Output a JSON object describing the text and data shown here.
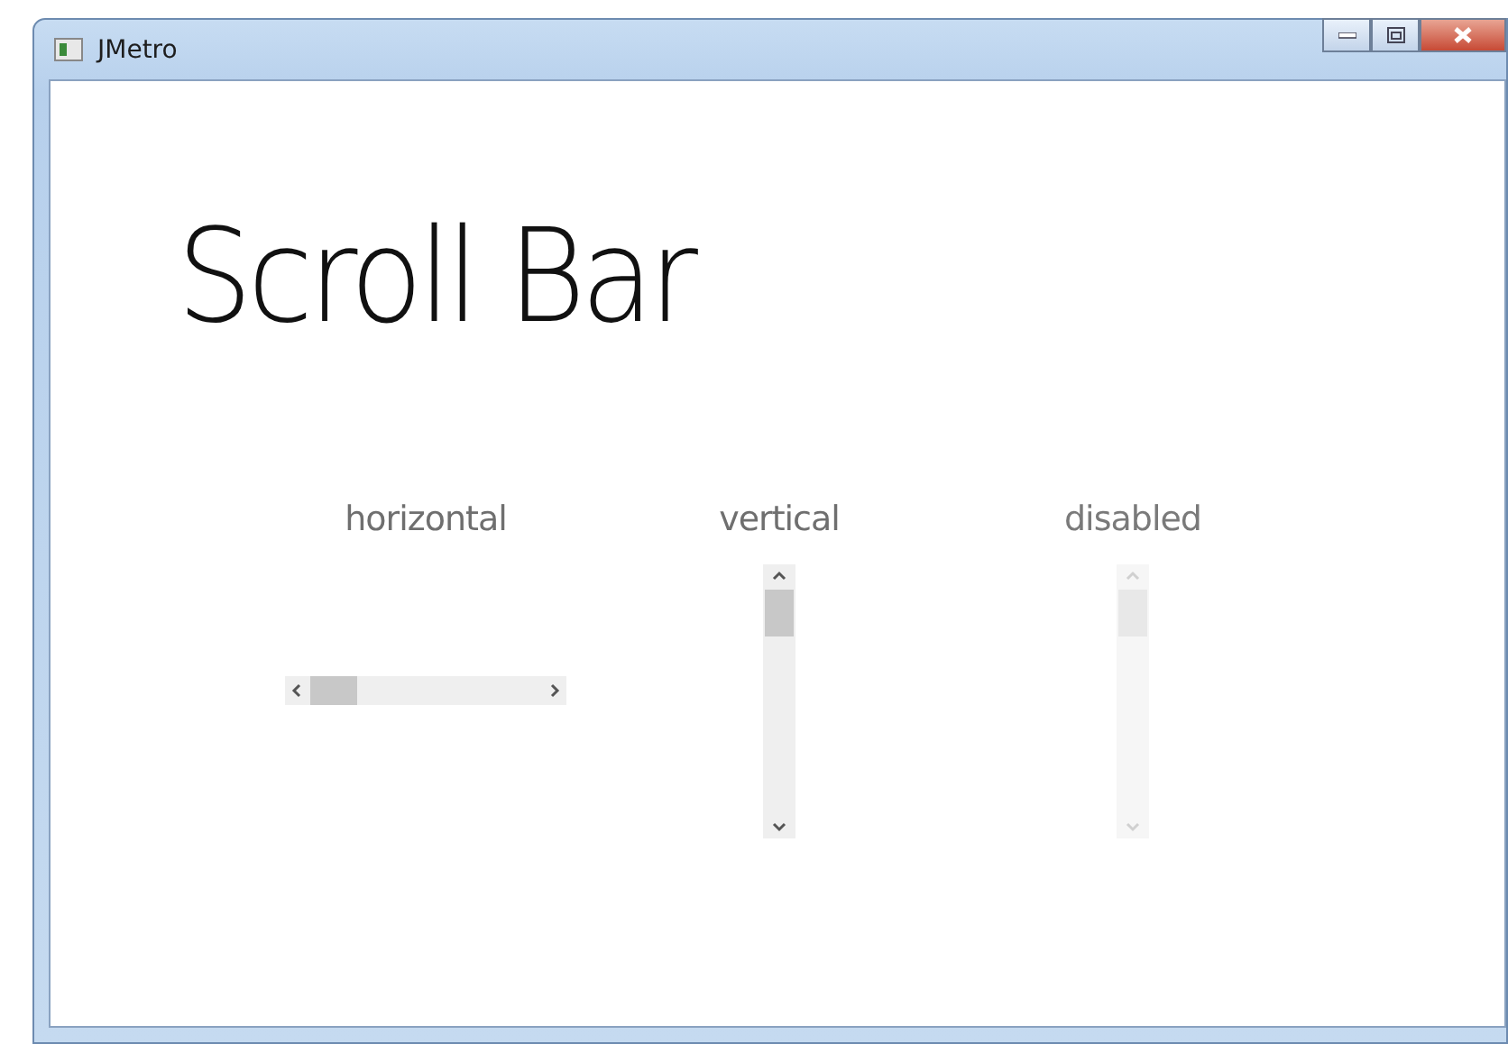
{
  "window": {
    "title": "JMetro"
  },
  "heading": "Scroll Bar",
  "scroll_bars": [
    {
      "label": "horizontal",
      "kind": "horizontal",
      "disabled": false
    },
    {
      "label": "vertical",
      "kind": "vertical",
      "disabled": false
    },
    {
      "label": "disabled",
      "kind": "vertical",
      "disabled": true
    }
  ]
}
